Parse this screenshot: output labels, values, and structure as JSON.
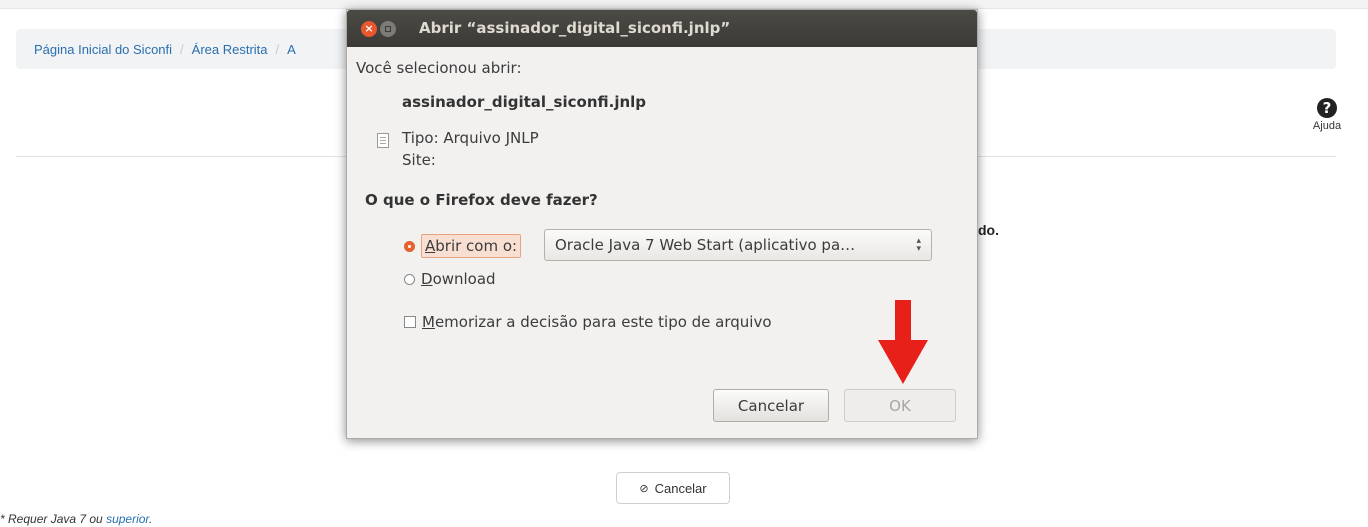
{
  "breadcrumb": {
    "home": "Página Inicial do Siconfi",
    "restricted": "Área Restrita",
    "partial": "A"
  },
  "help": {
    "icon": "question-circle-icon",
    "label": "Ajuda"
  },
  "background": {
    "trail_text": "do.",
    "cancel_label": "Cancelar",
    "cancel_icon": "ban-icon"
  },
  "footer": {
    "prefix": "* Requer Java 7 ou ",
    "link": "superior",
    "suffix": "."
  },
  "dialog": {
    "title": "Abrir “assinador_digital_siconfi.jnlp”",
    "intro": "Você selecionou abrir:",
    "file_name": "assinador_digital_siconfi.jnlp",
    "type_line": "Tipo: Arquivo JNLP",
    "site_line": "Site:",
    "question": "O que o Firefox deve fazer?",
    "open_with_label": "Abrir com o:",
    "open_with_value": "Oracle Java 7 Web Start (aplicativo pa…",
    "download_label": "Download",
    "remember_label": "Memorizar a decisão para este tipo de arquivo",
    "cancel_label": "Cancelar",
    "ok_label": "OK",
    "arrow_color": "#e8201a"
  }
}
